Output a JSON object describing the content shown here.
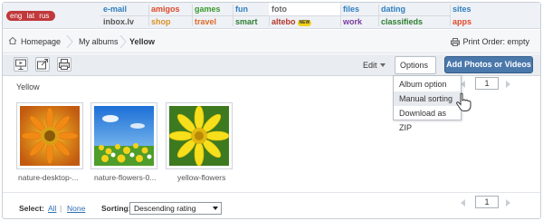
{
  "portal": {
    "languages": [
      "eng",
      "lat",
      "rus"
    ],
    "columns": [
      {
        "top": {
          "label": "e-mail",
          "color": "#2f7fbf"
        },
        "bottom": {
          "label": "inbox.lv",
          "color": "#555555"
        }
      },
      {
        "top": {
          "label": "amigos",
          "color": "#e0482a"
        },
        "bottom": {
          "label": "shop",
          "color": "#d9932a"
        }
      },
      {
        "top": {
          "label": "games",
          "color": "#3a9a2e"
        },
        "bottom": {
          "label": "travel",
          "color": "#e06a2a"
        }
      },
      {
        "top": {
          "label": "fun",
          "color": "#2f7fbf"
        },
        "bottom": {
          "label": "smart",
          "color": "#2e7d32"
        }
      },
      {
        "top": {
          "label": "foto",
          "color": "#666666"
        },
        "bottom": {
          "label": "altebo",
          "color": "#b2362b",
          "badge": "NEW"
        }
      },
      {
        "top": {
          "label": "files",
          "color": "#2f7fbf"
        },
        "bottom": {
          "label": "work",
          "color": "#7a3aa0"
        }
      },
      {
        "top": {
          "label": "dating",
          "color": "#2f7fbf"
        },
        "bottom": {
          "label": "classifieds",
          "color": "#2e7d32"
        }
      },
      {
        "top": {
          "label": "sites",
          "color": "#2f7fbf"
        },
        "bottom": {
          "label": "apps",
          "color": "#e0482a"
        }
      }
    ]
  },
  "breadcrumb": {
    "home": "Homepage",
    "albums": "My albums",
    "current": "Yellow"
  },
  "print_order": "Print Order: empty",
  "toolbar": {
    "edit": "Edit",
    "options": "Options",
    "add_button": "Add Photos or Videos"
  },
  "album_title": "Yellow",
  "options_menu": [
    "Album option",
    "Manual sorting",
    "Download as ZIP"
  ],
  "highlighted_menu_item": "Manual sorting",
  "pager": {
    "page": "1"
  },
  "photos": [
    {
      "caption": "nature-desktop-..."
    },
    {
      "caption": "nature-flowers-0..."
    },
    {
      "caption": "yellow-flowers"
    }
  ],
  "bottom": {
    "select_label": "Select:",
    "all": "All",
    "separator": "|",
    "none": "None",
    "sorting_label": "Sorting:",
    "sorting_value": "Descending rating"
  },
  "colors": {
    "accent_button": "#4a78ab",
    "language_pill": "#c0393b",
    "link": "#2f6fb5"
  }
}
